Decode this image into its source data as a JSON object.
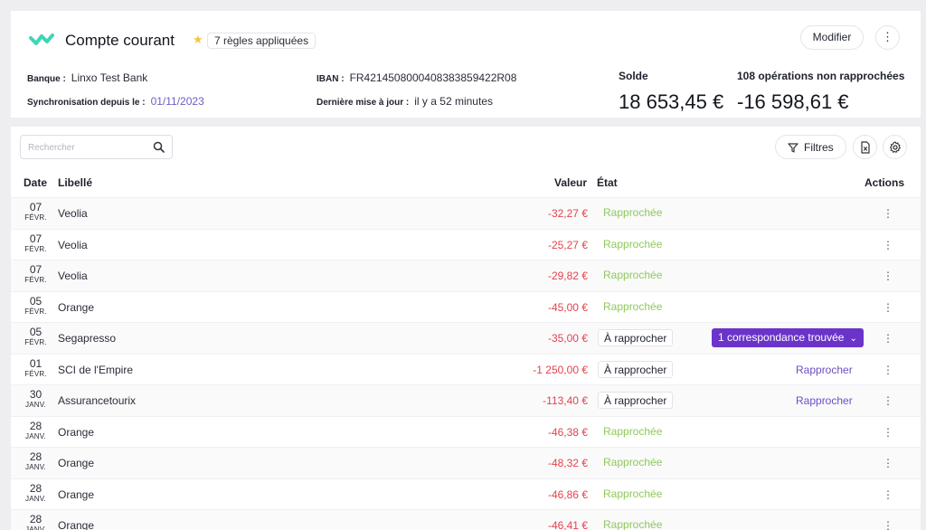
{
  "header": {
    "title": "Compte courant",
    "rules_badge": "7 règles appliquées",
    "modify_label": "Modifier",
    "more_glyph": "⋮",
    "bank_key": "Banque :",
    "bank_value": "Linxo Test Bank",
    "sync_key": "Synchronisation depuis le :",
    "sync_value": "01/11/2023",
    "iban_key": "IBAN :",
    "iban_value": "FR4214508000408383859422R08",
    "update_key": "Dernière mise à jour :",
    "update_value": "il y a 52 minutes",
    "solde_label": "Solde",
    "solde_value": "18 653,45 €",
    "unrec_label": "108 opérations non rapprochées",
    "unrec_value": "-16 598,61 €"
  },
  "toolbar": {
    "search_placeholder": "Rechercher",
    "filters_label": "Filtres"
  },
  "table": {
    "columns": {
      "date": "Date",
      "libelle": "Libellé",
      "valeur": "Valeur",
      "etat": "État",
      "actions": "Actions"
    },
    "rows": [
      {
        "day": "07",
        "month": "FÉVR.",
        "label": "Veolia",
        "value": "-32,27 €",
        "status": "Rapprochée",
        "action": ""
      },
      {
        "day": "07",
        "month": "FÉVR.",
        "label": "Veolia",
        "value": "-25,27 €",
        "status": "Rapprochée",
        "action": ""
      },
      {
        "day": "07",
        "month": "FÉVR.",
        "label": "Veolia",
        "value": "-29,82 €",
        "status": "Rapprochée",
        "action": ""
      },
      {
        "day": "05",
        "month": "FÉVR.",
        "label": "Orange",
        "value": "-45,00 €",
        "status": "Rapprochée",
        "action": ""
      },
      {
        "day": "05",
        "month": "FÉVR.",
        "label": "Segapresso",
        "value": "-35,00 €",
        "status": "À rapprocher",
        "action": "1 correspondance trouvée"
      },
      {
        "day": "01",
        "month": "FÉVR.",
        "label": "SCI de l'Empire",
        "value": "-1 250,00 €",
        "status": "À rapprocher",
        "action": "Rapprocher"
      },
      {
        "day": "30",
        "month": "JANV.",
        "label": "Assurancetourix",
        "value": "-113,40 €",
        "status": "À rapprocher",
        "action": "Rapprocher"
      },
      {
        "day": "28",
        "month": "JANV.",
        "label": "Orange",
        "value": "-46,38 €",
        "status": "Rapprochée",
        "action": ""
      },
      {
        "day": "28",
        "month": "JANV.",
        "label": "Orange",
        "value": "-48,32 €",
        "status": "Rapprochée",
        "action": ""
      },
      {
        "day": "28",
        "month": "JANV.",
        "label": "Orange",
        "value": "-46,86 €",
        "status": "Rapprochée",
        "action": ""
      },
      {
        "day": "28",
        "month": "JANV.",
        "label": "Orange",
        "value": "-46,41 €",
        "status": "Rapprochée",
        "action": ""
      }
    ]
  },
  "colors": {
    "accent": "#6b33c9",
    "negative": "#e3434d",
    "reconciled": "#8ec95a",
    "logo": "#3ad6b8"
  },
  "icons": {
    "logo": "linxo-logo",
    "star": "star-icon",
    "search": "search-icon",
    "filter": "filter-icon",
    "export": "file-export-icon",
    "settings": "gear-icon",
    "more": "more-vertical-icon"
  }
}
